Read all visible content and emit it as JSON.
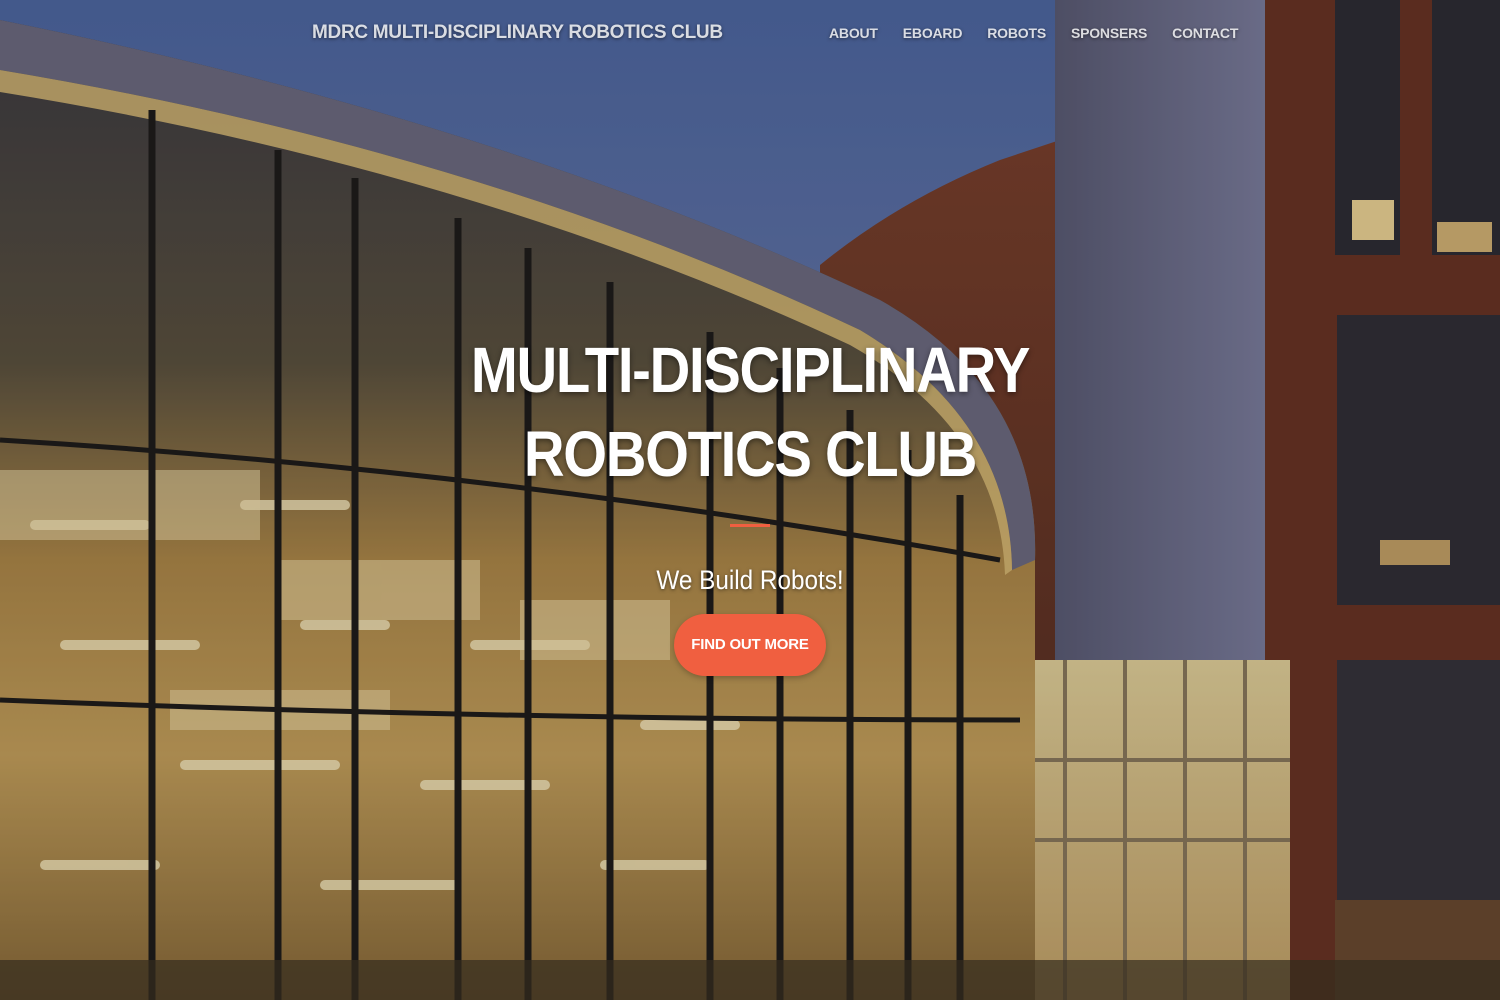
{
  "navbar": {
    "brand": "MDRC MULTI-DISCIPLINARY ROBOTICS CLUB",
    "links": [
      "ABOUT",
      "EBOARD",
      "ROBOTS",
      "SPONSERS",
      "CONTACT"
    ]
  },
  "hero": {
    "headline": "MULTI-DISCIPLINARY ROBOTICS CLUB",
    "tagline": "We Build Robots!",
    "cta_label": "FIND OUT MORE",
    "background_image": "night-photo-of-glass-campus-building"
  },
  "colors": {
    "accent": "#f05f40",
    "text": "#ffffff"
  }
}
